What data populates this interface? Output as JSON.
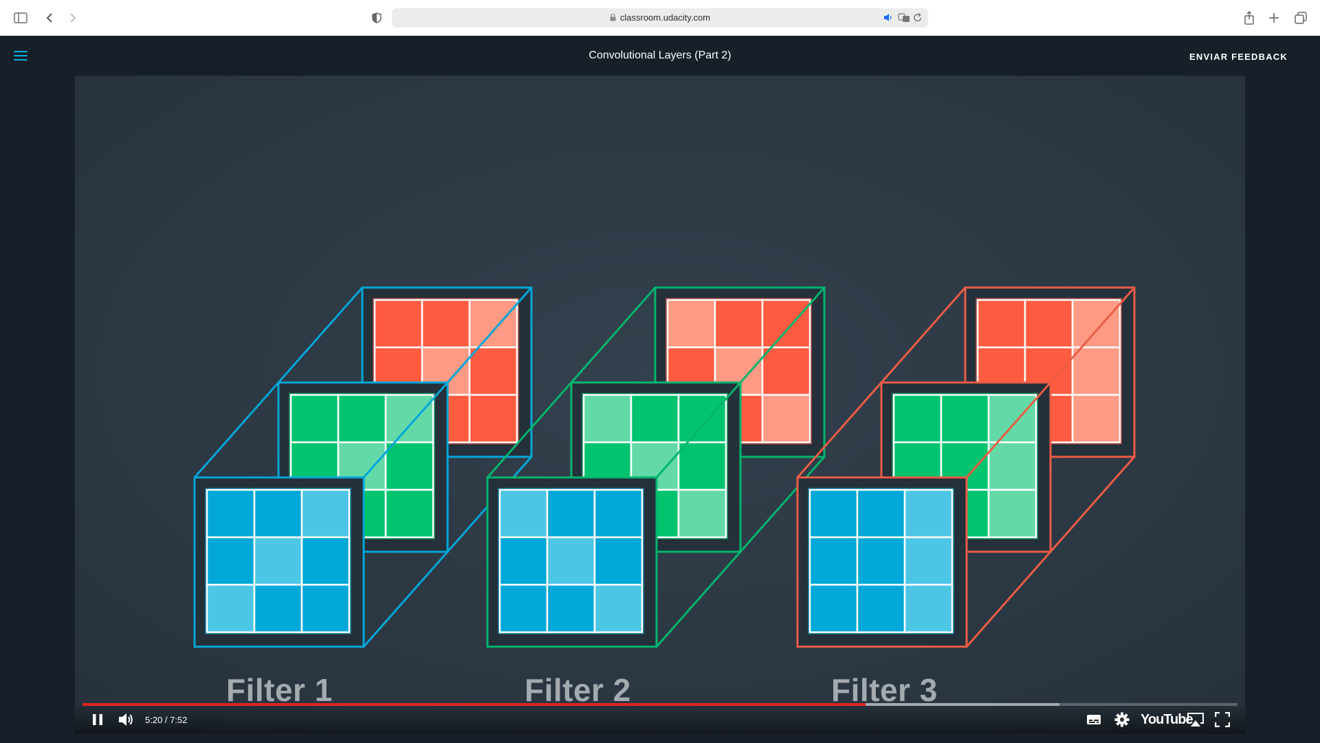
{
  "browser": {
    "url": "classroom.udacity.com"
  },
  "header": {
    "title": "Convolutional Layers (Part 2)",
    "feedback_label": "ENVIAR FEEDBACK"
  },
  "video": {
    "filters": [
      {
        "label": "Filter 1",
        "outline_color": "#02a7d8"
      },
      {
        "label": "Filter 2",
        "outline_color": "#02b56e"
      },
      {
        "label": "Filter 3",
        "outline_color": "#ec5c45"
      }
    ],
    "colors": {
      "red_dark": "#ff5b40",
      "red_light": "#ff9b85",
      "green_dark": "#02c46e",
      "green_light": "#63d9a8",
      "blue_dark": "#02a8d8",
      "blue_light": "#4dc6e6"
    },
    "kernels": [
      {
        "red": [
          [
            1,
            1,
            0
          ],
          [
            1,
            0,
            1
          ],
          [
            0,
            1,
            1
          ]
        ],
        "green": [
          [
            1,
            1,
            0
          ],
          [
            1,
            0,
            1
          ],
          [
            0,
            1,
            1
          ]
        ],
        "blue": [
          [
            1,
            1,
            0
          ],
          [
            1,
            0,
            1
          ],
          [
            0,
            1,
            1
          ]
        ]
      },
      {
        "red": [
          [
            0,
            1,
            1
          ],
          [
            1,
            0,
            1
          ],
          [
            1,
            1,
            0
          ]
        ],
        "green": [
          [
            0,
            1,
            1
          ],
          [
            1,
            0,
            1
          ],
          [
            1,
            1,
            0
          ]
        ],
        "blue": [
          [
            0,
            1,
            1
          ],
          [
            1,
            0,
            1
          ],
          [
            1,
            1,
            0
          ]
        ]
      },
      {
        "red": [
          [
            1,
            1,
            0
          ],
          [
            1,
            1,
            0
          ],
          [
            1,
            1,
            0
          ]
        ],
        "green": [
          [
            1,
            1,
            0
          ],
          [
            1,
            1,
            0
          ],
          [
            1,
            1,
            0
          ]
        ],
        "blue": [
          [
            1,
            1,
            0
          ],
          [
            1,
            1,
            0
          ],
          [
            1,
            1,
            0
          ]
        ]
      }
    ],
    "player": {
      "time_display": "5:20 / 7:52",
      "played_fraction": 0.6782,
      "buffered_fraction": 0.8457,
      "brand": "YouTube"
    }
  }
}
